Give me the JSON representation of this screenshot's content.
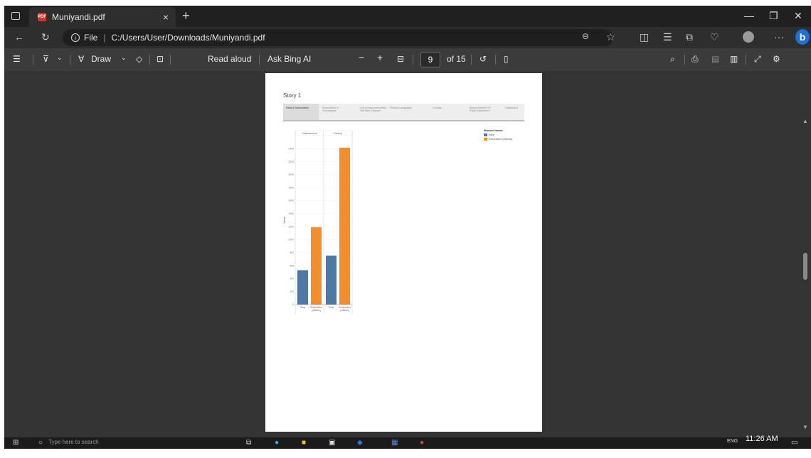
{
  "browser": {
    "tab_title": "Muniyandi.pdf",
    "tab_close": "×",
    "new_tab": "+",
    "url_prefix": "File",
    "url": "C:/Users/User/Downloads/Muniyandi.pdf"
  },
  "toolbar": {
    "draw_label": "Draw",
    "read_aloud_label": "Read aloud",
    "ask_bing_label": "Ask Bing AI",
    "zoom_out": "−",
    "zoom_in": "+",
    "page_current": "9",
    "page_total": "of 15"
  },
  "document": {
    "story_title": "Story 1",
    "story_points": [
      "Rank & Subscribers",
      "Subscribers in Countrywise",
      "List of most subscribed YouTube Channel",
      "Primary Languages",
      "Country",
      "Brand Channel VS Rank,Subscribers",
      "Dashboard"
    ]
  },
  "chart_data": {
    "type": "bar",
    "panels": [
      "Entertainment",
      "Gaming"
    ],
    "categories": [
      "Rank",
      "Subscribers (millions)"
    ],
    "series": [
      {
        "name": "Rank",
        "color": "#4e79a7",
        "values": [
          530,
          755
        ]
      },
      {
        "name": "Subscribers (millions)",
        "color": "#f28e2b",
        "values": [
          1190,
          2415
        ]
      }
    ],
    "legend_title": "Measure Names",
    "legend_labels": [
      "Rank",
      "Subscribers (millions)"
    ],
    "ylabel": "Value",
    "yticks": [
      0,
      200,
      400,
      600,
      800,
      1000,
      1200,
      1400,
      1600,
      1800,
      2000,
      2200,
      2400
    ],
    "ylim": [
      0,
      2600
    ],
    "legend_position": "top-right"
  },
  "taskbar": {
    "search_placeholder": "Type here to search",
    "time": "11:26 AM",
    "language": "ENG"
  }
}
